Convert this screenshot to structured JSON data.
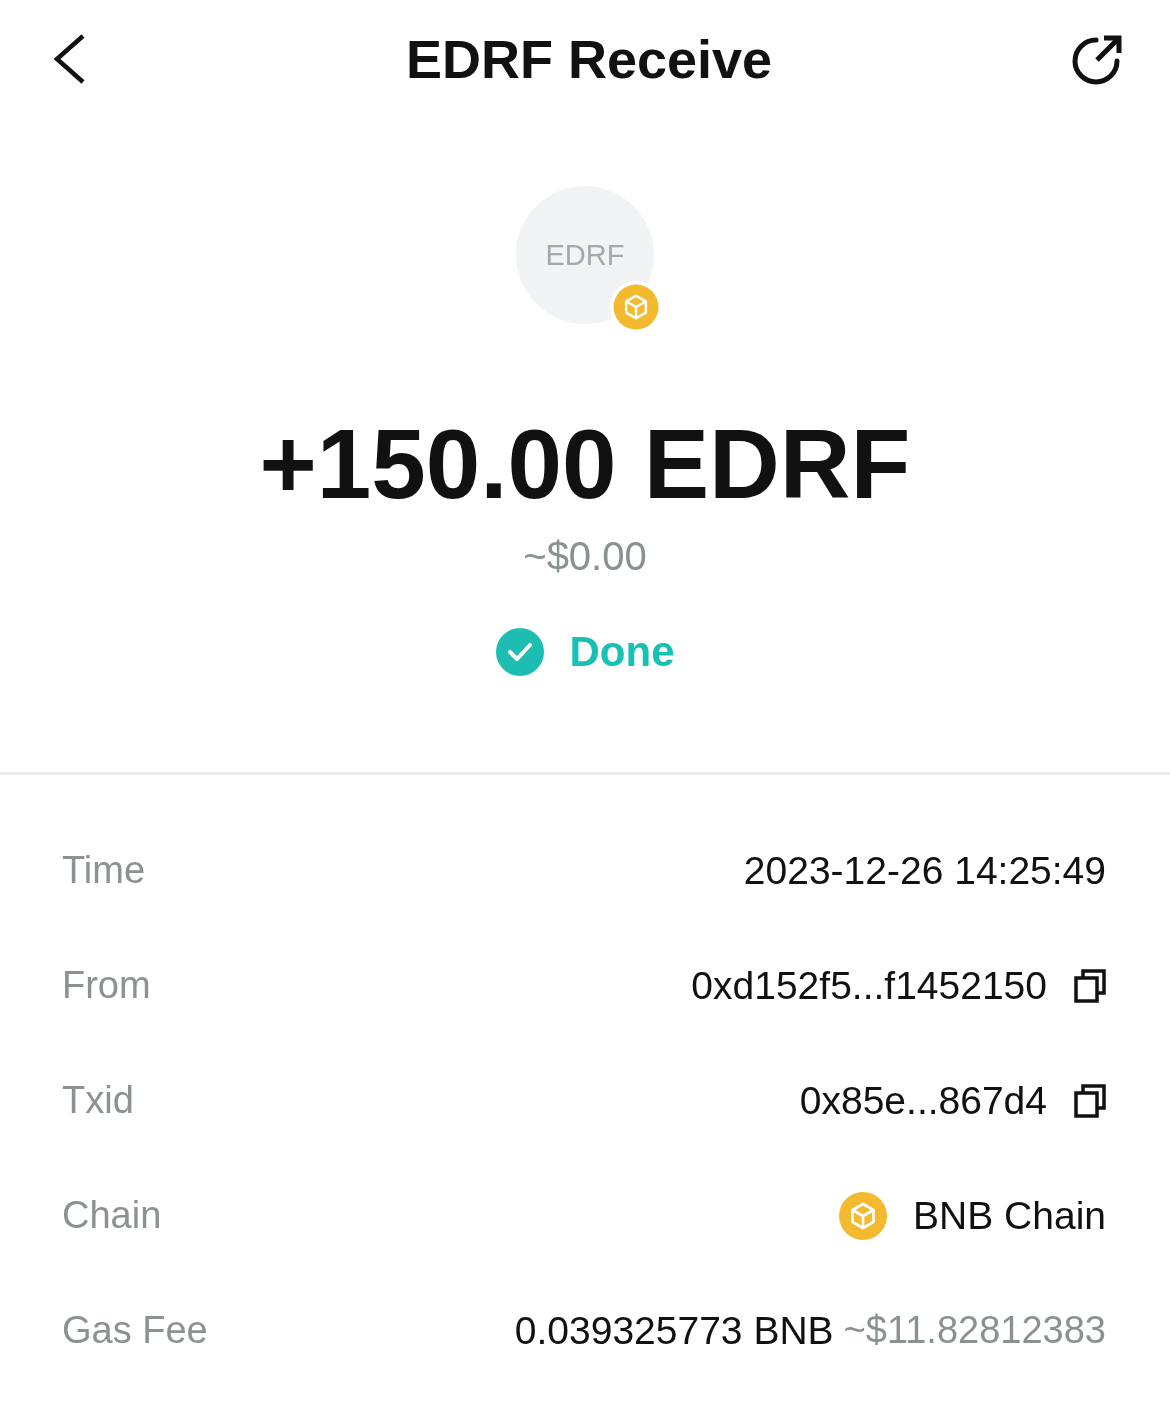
{
  "header": {
    "title": "EDRF Receive"
  },
  "token": {
    "symbol": "EDRF"
  },
  "amount": "+150.00 EDRF",
  "fiat": "~$0.00",
  "status": {
    "kind": "done",
    "label": "Done"
  },
  "details": [
    {
      "kind": "text",
      "label": "Time",
      "value": "2023-12-26 14:25:49"
    },
    {
      "kind": "copy",
      "label": "From",
      "value": "0xd152f5...f1452150"
    },
    {
      "kind": "copy",
      "label": "Txid",
      "value": "0x85e...867d4"
    },
    {
      "kind": "chain",
      "label": "Chain",
      "value": "BNB Chain"
    },
    {
      "kind": "fee",
      "label": "Gas Fee",
      "value": "0.039325773 BNB",
      "fiat": "~$11.82812383"
    }
  ]
}
